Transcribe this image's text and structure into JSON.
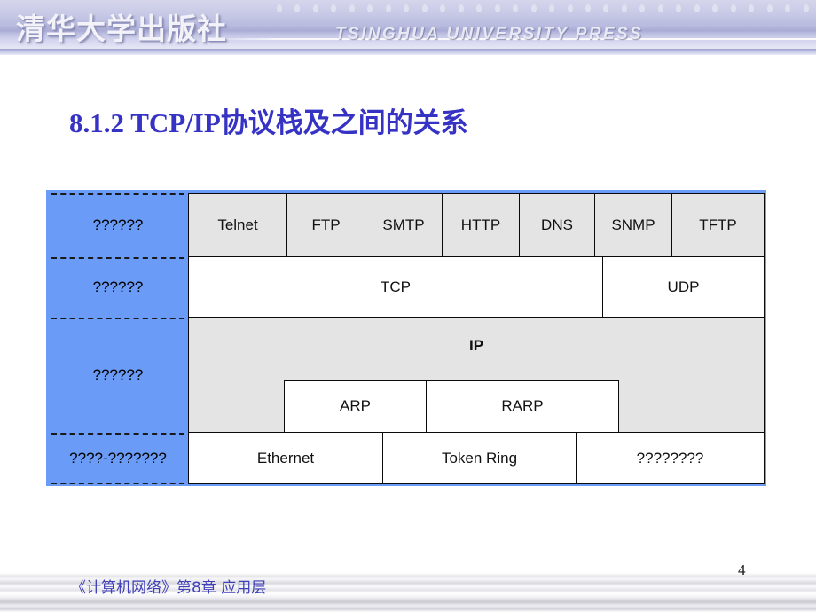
{
  "header": {
    "logo_cn": "清华大学出版社",
    "logo_en": "TSINGHUA UNIVERSITY PRESS",
    "dot_count": 30
  },
  "slide": {
    "title": "8.1.2  TCP/IP协议栈及之间的关系"
  },
  "diagram": {
    "layers": [
      {
        "label": "??????"
      },
      {
        "label": "??????"
      },
      {
        "label": "??????"
      },
      {
        "label": "????-???????"
      }
    ],
    "application_row": [
      "Telnet",
      "FTP",
      "SMTP",
      "HTTP",
      "DNS",
      "SNMP",
      "TFTP"
    ],
    "transport_row": [
      "TCP",
      "UDP"
    ],
    "internet_row": {
      "main": "IP",
      "sub": [
        "ARP",
        "RARP"
      ]
    },
    "link_row": [
      "Ethernet",
      "Token Ring",
      "????????"
    ],
    "colors": {
      "layer_column": "#6a9bf7",
      "gray_cell": "#e4e4e4",
      "white_cell": "#ffffff",
      "border": "#0a0a0a",
      "outer_border": "#6a9bf7"
    }
  },
  "footer": {
    "text": "《计算机网络》第8章  应用层",
    "page_number": "4"
  }
}
